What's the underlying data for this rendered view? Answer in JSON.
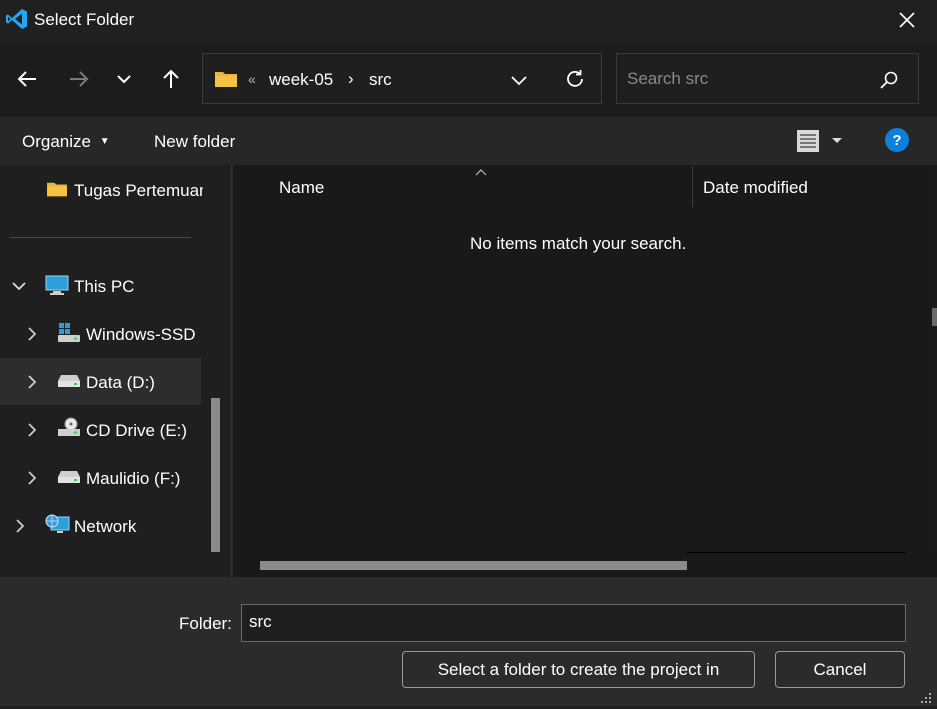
{
  "window": {
    "title": "Select Folder",
    "app_icon": "vscode-icon",
    "close_icon": "close-icon"
  },
  "nav": {
    "back_icon": "arrow-left-icon",
    "forward_icon": "arrow-right-icon",
    "recent_icon": "chevron-down-icon",
    "up_icon": "arrow-up-icon"
  },
  "address": {
    "folder_icon": "folder-icon",
    "overflow": "«",
    "segments": [
      "week-05",
      "src"
    ],
    "separator": "›",
    "dropdown_icon": "chevron-down-icon",
    "refresh_icon": "refresh-icon"
  },
  "search": {
    "placeholder": "Search src",
    "icon": "search-icon"
  },
  "toolbar": {
    "organize_label": "Organize",
    "new_folder_label": "New folder",
    "view_icon": "view-list-icon",
    "help_label": "?"
  },
  "navpane": {
    "items": [
      {
        "label": "Tugas Pertemuan",
        "icon": "folder-icon",
        "expander": false
      },
      {
        "label": "This PC",
        "icon": "monitor-icon",
        "expander": "expanded"
      },
      {
        "label": "Windows-SSD",
        "icon": "windows-drive-icon",
        "expander": "collapsed"
      },
      {
        "label": "Data (D:)",
        "icon": "drive-icon",
        "expander": "collapsed",
        "selected": true
      },
      {
        "label": "CD Drive (E:)",
        "icon": "cd-drive-icon",
        "expander": "collapsed"
      },
      {
        "label": "Maulidio (F:)",
        "icon": "drive-icon",
        "expander": "collapsed"
      },
      {
        "label": "Network",
        "icon": "network-icon",
        "expander": "collapsed"
      }
    ]
  },
  "content": {
    "columns": [
      "Name",
      "Date modified"
    ],
    "sort_indicator": "^",
    "empty_message": "No items match your search."
  },
  "footer": {
    "folder_label": "Folder:",
    "folder_value": "src",
    "select_button": "Select a folder to create the project in",
    "cancel_button": "Cancel"
  },
  "colors": {
    "background": "#202020",
    "content_bg": "#191919",
    "footer_bg": "#2b2b2b",
    "accent_blue": "#0078d4",
    "folder_yellow": "#f5c242"
  }
}
